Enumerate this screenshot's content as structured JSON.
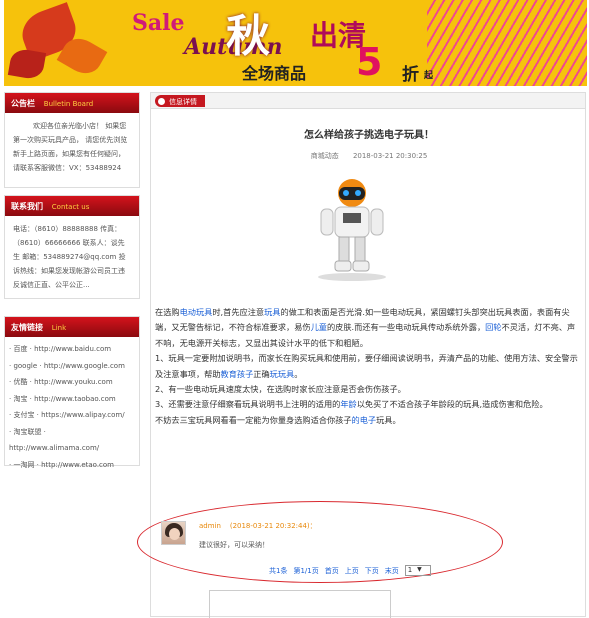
{
  "banner": {
    "sale": "Sale",
    "qiu": "秋",
    "chuqing": "出清",
    "autumn": "Autumn",
    "quanchang": "全场商品",
    "num": "5",
    "zhe": "折",
    "qi": "起"
  },
  "sidebar": {
    "notice": {
      "title": "公告栏",
      "en": "Bulletin Board",
      "text": "欢迎各位亲光临小店！ 如果您第一次购买玩具产品， 请您优先浏览新手上路页面，如果您有任何疑问，请联系客服微信：VX：53488924"
    },
    "contact": {
      "title": "联系我们",
      "en": "Contact us",
      "text": "电话：（8610）88888888 传真：（8610）66666666 联系人：谈先生 邮箱：534889274@qq.com 投诉热线：如果您发现帐游公司员工违反诚信正直、公平公正..."
    },
    "links": {
      "title": "友情链接",
      "en": "Link",
      "items": [
        "· 百度 · http://www.baidu.com",
        "· google · http://www.google.com",
        "· 优酷 · http://www.youku.com",
        "· 淘宝 · http://www.taobao.com",
        "· 支付宝 · https://www.alipay.com/",
        "· 淘宝联盟 · http://www.alimama.com/",
        "· 一淘网 · http://www.etao.com"
      ]
    }
  },
  "main": {
    "header": "信息详情",
    "title": "怎么样给孩子挑选电子玩具！",
    "category": "商城动态",
    "date": "2018-03-21 20:30:25",
    "content": {
      "p1a": "在选购",
      "l1": "电动玩具",
      "p1b": "时,首先应注意",
      "l2": "玩具",
      "p1c": "的做工和表面是否光滑.如一些电动玩具，紧固螺钉头部突出玩具表面，表面有尖端，又无警告标记，不符合标准要求，易伤",
      "l3": "儿童",
      "p1d": "的皮肤.而还有一些电动玩具传动系统外露，",
      "l4": "回轮",
      "p1e": "不灵活，灯不亮、声不响，无电源开关标志，又显出其设计水平的低下和粗陋。",
      "p2a": "1、玩具一定要附加说明书，而家长在购买玩具和使用前，要仔细阅读说明书，弄清产品的功能、使用方法、安全警示及注意事项，帮助",
      "l5": "教育孩子",
      "p2b": "正确",
      "l6": "玩玩具",
      "p2c": "。",
      "p3": "2、有一些电动玩具速度太快，在选购时家长应注意是否会伤伤孩子。",
      "p4a": "3、还需要注意仔细察看玩具说明书上注明的适用的",
      "l7": "年龄",
      "p4b": "以免买了不适合孩子年龄段的玩具,造成伤害和危险。",
      "p5a": "不妨去三宝玩具网看看一定能为你量身选购适合你孩子",
      "l8": "的电子",
      "p5b": "玩具。"
    },
    "comment": {
      "user": "admin",
      "date": "(2018-03-21 20:32:44)：",
      "text": "建议很好，可以采纳！"
    },
    "pager": {
      "total": "共1条",
      "page": "第1/1页",
      "first": "首页",
      "prev": "上页",
      "next": "下页",
      "last": "末页",
      "select": "1"
    }
  }
}
